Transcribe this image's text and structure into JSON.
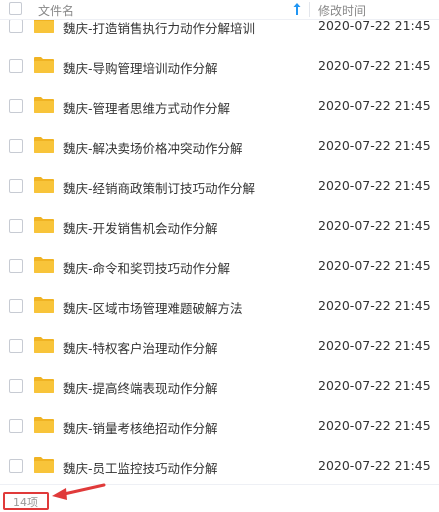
{
  "header": {
    "column_name": "文件名",
    "column_time": "修改时间",
    "sort_icon": "sort-ascending-arrow-icon"
  },
  "rows": [
    {
      "name": "魏庆-打造销售执行力动作分解培训",
      "time": "2020-07-22 21:45"
    },
    {
      "name": "魏庆-导购管理培训动作分解",
      "time": "2020-07-22 21:45"
    },
    {
      "name": "魏庆-管理者思维方式动作分解",
      "time": "2020-07-22 21:45"
    },
    {
      "name": "魏庆-解决卖场价格冲突动作分解",
      "time": "2020-07-22 21:45"
    },
    {
      "name": "魏庆-经销商政策制订技巧动作分解",
      "time": "2020-07-22 21:45"
    },
    {
      "name": "魏庆-开发销售机会动作分解",
      "time": "2020-07-22 21:45"
    },
    {
      "name": "魏庆-命令和奖罚技巧动作分解",
      "time": "2020-07-22 21:45"
    },
    {
      "name": "魏庆-区域市场管理难题破解方法",
      "time": "2020-07-22 21:45"
    },
    {
      "name": "魏庆-特权客户治理动作分解",
      "time": "2020-07-22 21:45"
    },
    {
      "name": "魏庆-提高终端表现动作分解",
      "time": "2020-07-22 21:45"
    },
    {
      "name": "魏庆-销量考核绝招动作分解",
      "time": "2020-07-22 21:45"
    },
    {
      "name": "魏庆-员工监控技巧动作分解",
      "time": "2020-07-22 21:45"
    }
  ],
  "footer": {
    "count": "14项"
  },
  "colors": {
    "folder": "#f8c43a",
    "folder_dark": "#f0b323",
    "annotation": "#e03a3a",
    "sort_icon": "#2196f3"
  }
}
